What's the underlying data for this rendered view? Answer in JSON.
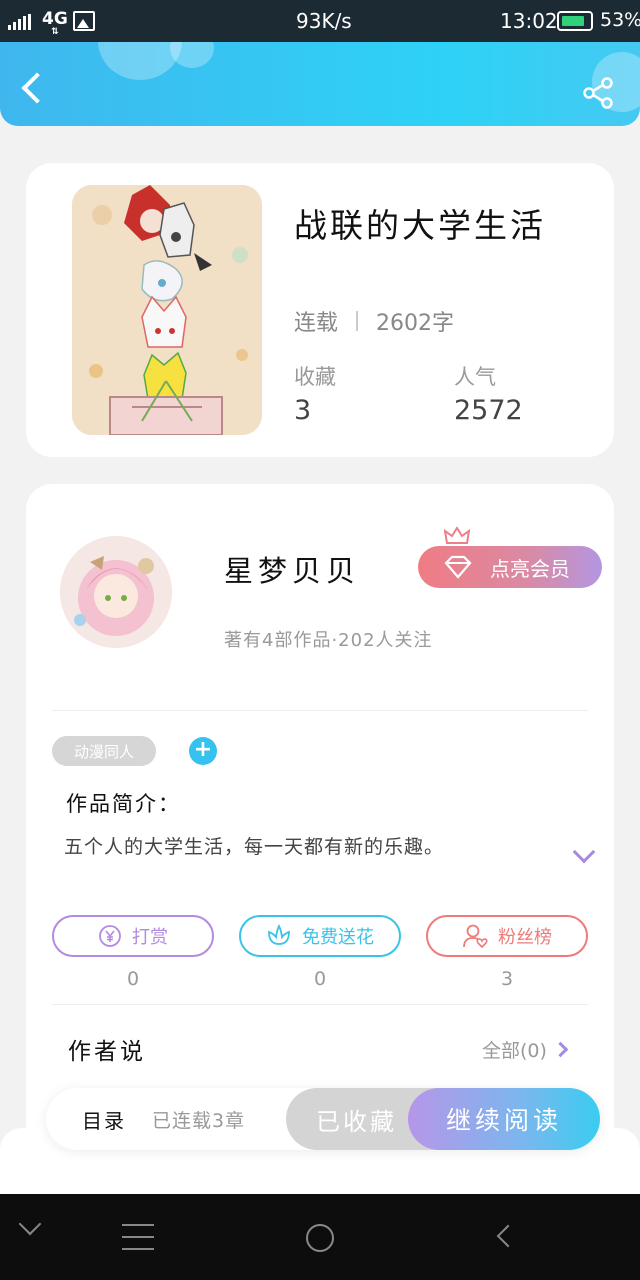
{
  "status_bar": {
    "network": "4G",
    "speed": "93K/s",
    "time": "13:02",
    "battery": "53%",
    "battery_level": 0.53,
    "icons": [
      "signal-icon",
      "image-notification-icon",
      "battery-icon"
    ]
  },
  "header": {
    "back_icon": "chevron-left-icon",
    "share_icon": "share-icon",
    "colors": {
      "start": "#3fb7ee",
      "end": "#2ed2f6"
    }
  },
  "book": {
    "title": "战联的大学生活",
    "status": "连载",
    "word_count": "2602字",
    "favorites_label": "收藏",
    "favorites_value": "3",
    "popularity_label": "人气",
    "popularity_value": "2572"
  },
  "author": {
    "name": "星梦贝贝",
    "vip_button": "点亮会员",
    "meta": "著有4部作品·202人关注",
    "tag": "动漫同人",
    "add_tag": "+",
    "intro_label": "作品简介：",
    "intro_text": "五个人的大学生活，每一天都有新的乐趣。"
  },
  "actions": [
    {
      "label": "打赏",
      "count": "0",
      "icon": "yen-coin-icon",
      "color": "#b28be0"
    },
    {
      "label": "免费送花",
      "count": "0",
      "icon": "flower-icon",
      "color": "#3ac3e8"
    },
    {
      "label": "粉丝榜",
      "count": "3",
      "icon": "fan-heart-icon",
      "color": "#ee7a7a"
    }
  ],
  "author_says": {
    "label": "作者说",
    "all_link": "全部(0)"
  },
  "bottom_bar": {
    "toc_label": "目录",
    "chapter_count": "已连载3章",
    "favorited_button": "已收藏",
    "continue_button": "继续阅读"
  },
  "nav_bar": {
    "icons": [
      "nav-collapse-icon",
      "nav-menu-icon",
      "nav-home-icon",
      "nav-back-icon"
    ]
  },
  "accent_purple": "#a68bde"
}
